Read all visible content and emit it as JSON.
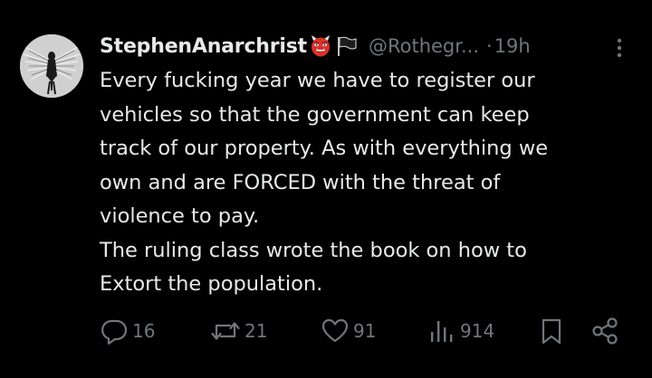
{
  "author": {
    "display_name": "StephenAnarchrist",
    "handle": "@Rothegr...",
    "separator": "·",
    "time": "19h"
  },
  "post": {
    "lines": [
      "Every fucking year we have to register our",
      "vehicles so that the government can keep",
      "track of our property. As with everything we",
      "own and are FORCED with the threat of",
      "violence to pay.",
      "The ruling class wrote the book on how to",
      "Extort the population."
    ]
  },
  "actions": {
    "replies": "16",
    "reposts": "21",
    "likes": "91",
    "views": "914"
  },
  "icons": {
    "avatar": "winged-figure-avatar",
    "badge_1": "ogre-emoji",
    "badge_2": "black-flag-emoji",
    "more": "more-vertical-icon",
    "reply": "reply-bubble-icon",
    "repost": "repost-icon",
    "like": "heart-icon",
    "views": "views-bar-chart-icon",
    "bookmark": "bookmark-icon",
    "share": "share-icon"
  },
  "colors": {
    "background": "#000000",
    "primary_text": "#e7e9ea",
    "secondary_text": "#71767b"
  }
}
